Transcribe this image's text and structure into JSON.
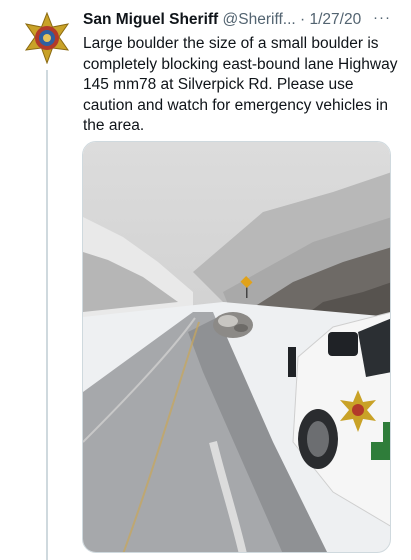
{
  "tweet": {
    "author_name": "San Miguel Sheriff",
    "handle": "@Sheriff...",
    "separator": "·",
    "date": "1/27/20",
    "more_label": "···",
    "text": "Large boulder the size of a small boulder is completely blocking east-bound lane Highway 145 mm78 at Silverpick Rd. Please use caution and watch for emergency vehicles in the area."
  },
  "icons": {
    "avatar": "sheriff-star-badge-icon",
    "more": "more-options-icon"
  },
  "colors": {
    "text_primary": "#0f1419",
    "text_secondary": "#536471",
    "badge_gold": "#c9a227",
    "badge_red": "#b23a2a",
    "vehicle_green": "#2f7d3a"
  }
}
